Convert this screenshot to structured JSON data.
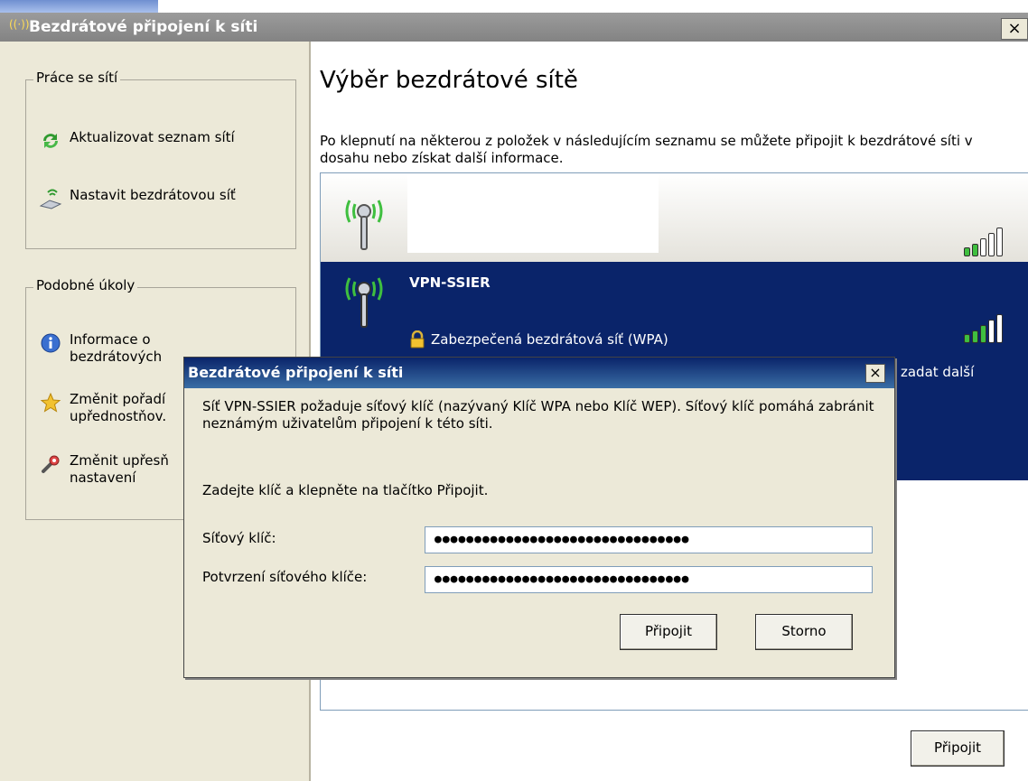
{
  "window": {
    "title": "Bezdrátové připojení k síti",
    "close_label": "×"
  },
  "sidebar": {
    "group1": {
      "legend": "Práce se sítí",
      "items": [
        {
          "label": "Aktualizovat seznam sítí",
          "icon": "refresh-icon"
        },
        {
          "label": "Nastavit bezdrátovou síť",
          "icon": "wireless-setup-icon"
        }
      ]
    },
    "group2": {
      "legend": "Podobné úkoly",
      "items": [
        {
          "label_line1": "Informace o",
          "label_line2": "bezdrátových",
          "icon": "info-icon"
        },
        {
          "label_line1": "Změnit pořadí",
          "label_line2": "upřednostňov.",
          "icon": "star-icon"
        },
        {
          "label_line1": "Změnit upřesň",
          "label_line2": "nastavení",
          "icon": "settings-icon"
        }
      ]
    }
  },
  "main": {
    "title": "Výběr bezdrátové sítě",
    "description": "Po klepnutí na některou z položek v následujícím seznamu se můžete připojit k bezdrátové síti v dosahu nebo získat další informace.",
    "networks": [
      {
        "ssid": "",
        "security": "",
        "signal_bars": 2
      },
      {
        "ssid": "VPN-SSIER",
        "security": "Zabezpečená bezdrátová síť (WPA)",
        "extra": "é zadat další",
        "signal_bars": 3
      }
    ],
    "connect_label": "Připojit"
  },
  "dialog": {
    "title": "Bezdrátové připojení k síti",
    "close_label": "×",
    "message": "Síť VPN-SSIER požaduje síťový klíč (nazývaný Klíč WPA nebo Klíč WEP). Síťový klíč pomáhá zabránit neznámým uživatelům připojení k této síti.",
    "instruction": "Zadejte klíč a klepněte na tlačítko Připojit.",
    "key_label": "Síťový klíč:",
    "key_value": "●●●●●●●●●●●●●●●●●●●●●●●●●●●●●●●●",
    "confirm_label": "Potvrzení síťového klíče:",
    "confirm_value": "●●●●●●●●●●●●●●●●●●●●●●●●●●●●●●●●",
    "connect_label": "Připojit",
    "cancel_label": "Storno"
  }
}
